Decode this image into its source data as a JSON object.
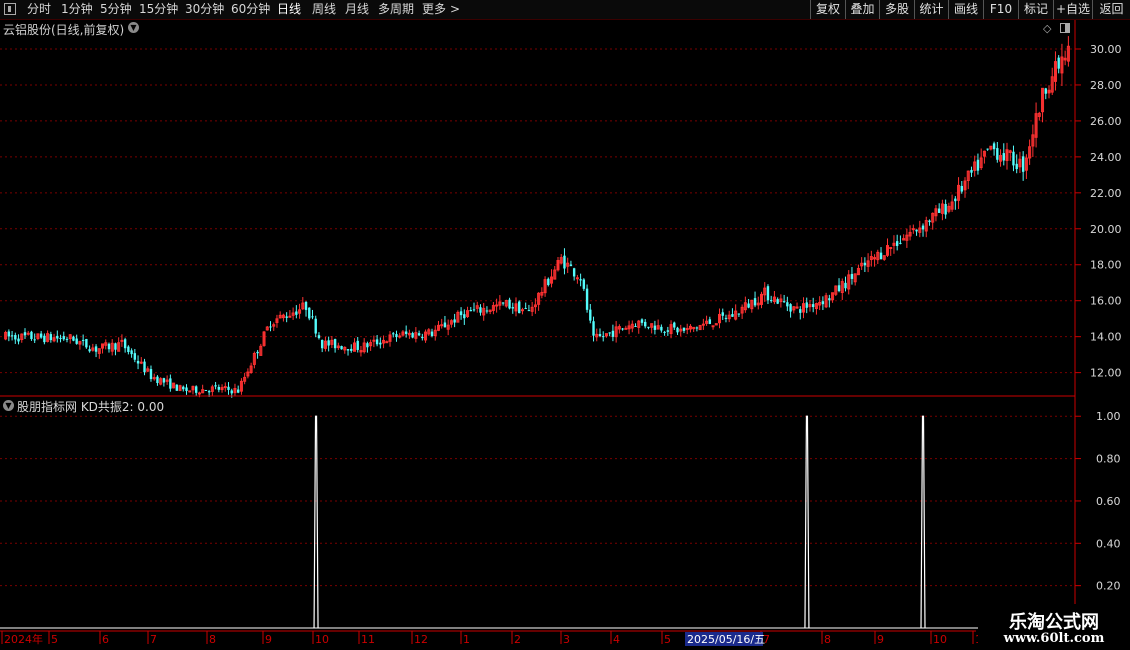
{
  "toolbar": {
    "periods": [
      "分时",
      "1分钟",
      "5分钟",
      "15分钟",
      "30分钟",
      "60分钟",
      "日线",
      "周线",
      "月线",
      "多周期",
      "更多"
    ],
    "active_period": "日线",
    "more_arrow": ">",
    "right_buttons": [
      "复权",
      "叠加",
      "多股",
      "统计",
      "画线",
      "F10",
      "标记",
      "+自选",
      "返回"
    ]
  },
  "main_panel": {
    "title": "云铝股份(日线,前复权)"
  },
  "sub_panel": {
    "title": "股朋指标网  KD共振2: 0.00"
  },
  "watermark": {
    "line1": "乐淘公式网",
    "line2": "www.60lt.com"
  },
  "colors": {
    "up": "#ff3232",
    "down": "#54fcfc",
    "grid": "#7a0000",
    "axis": "#cc0000",
    "signal": "#ffffff"
  },
  "chart_data": [
    {
      "type": "candlestick",
      "title": "",
      "y_ticks": [
        "12.00",
        "14.00",
        "16.00",
        "18.00",
        "20.00",
        "22.00",
        "24.00",
        "26.00",
        "28.00",
        "30.00"
      ],
      "ylim": [
        10.7,
        30.5
      ],
      "grid": true,
      "trend_anchors": [
        [
          0,
          14.0
        ],
        [
          20,
          13.9
        ],
        [
          28,
          13.3
        ],
        [
          36,
          13.6
        ],
        [
          45,
          11.8
        ],
        [
          55,
          11.0
        ],
        [
          65,
          11.1
        ],
        [
          72,
          11.0
        ],
        [
          82,
          14.8
        ],
        [
          93,
          15.7
        ],
        [
          98,
          13.6
        ],
        [
          110,
          13.4
        ],
        [
          122,
          14.1
        ],
        [
          132,
          14.2
        ],
        [
          142,
          15.3
        ],
        [
          155,
          15.8
        ],
        [
          162,
          15.4
        ],
        [
          172,
          18.3
        ],
        [
          178,
          17.3
        ],
        [
          182,
          13.8
        ],
        [
          195,
          14.8
        ],
        [
          210,
          14.3
        ],
        [
          225,
          15.2
        ],
        [
          235,
          16.4
        ],
        [
          245,
          15.5
        ],
        [
          255,
          16.2
        ],
        [
          265,
          17.8
        ],
        [
          272,
          18.8
        ],
        [
          282,
          20.0
        ],
        [
          292,
          21.3
        ],
        [
          305,
          24.5
        ],
        [
          315,
          23.5
        ],
        [
          322,
          28.0
        ],
        [
          329,
          29.8
        ]
      ]
    },
    {
      "type": "line",
      "title": "",
      "y_ticks": [
        "0.20",
        "0.40",
        "0.60",
        "0.80",
        "1.00"
      ],
      "ylim": [
        0.0,
        1.02
      ],
      "signals": [
        {
          "date": "2024-09-19",
          "value": 1.0
        },
        {
          "date": "2025-06-04",
          "value": 1.0
        },
        {
          "date": "2025-08-04",
          "value": 1.0
        }
      ],
      "x_ticks": [
        "2024年",
        "5",
        "6",
        "7",
        "8",
        "9",
        "10",
        "11",
        "12",
        "1",
        "2",
        "3",
        "4",
        "5",
        "7",
        "8",
        "9",
        "10",
        "1"
      ],
      "cursor_label": "2025/05/16/五"
    }
  ]
}
